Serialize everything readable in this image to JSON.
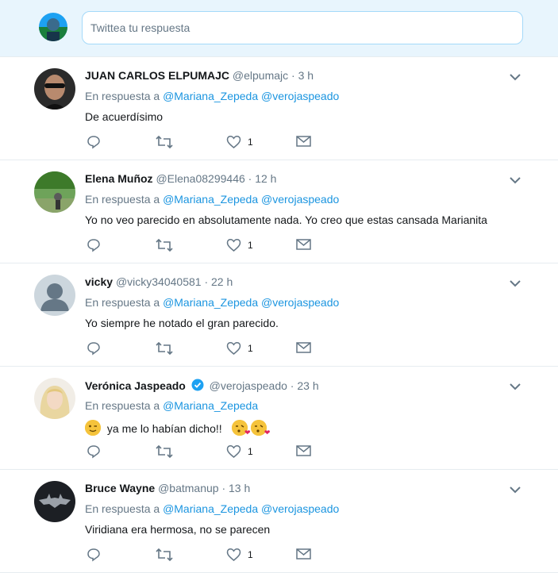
{
  "compose": {
    "placeholder": "Twittea tu respuesta",
    "avatar_icon": "user-avatar-icon"
  },
  "colors": {
    "accent": "#1b95e0",
    "compose_bg": "#e8f5fd",
    "muted": "#657786",
    "text": "#14171a",
    "border": "#e6ecf0"
  },
  "tweets": [
    {
      "name": "JUAN CARLOS ELPUMAJC",
      "handle": "@elpumajc",
      "dot": "·",
      "time": "3 h",
      "reply_prefix": "En respuesta a",
      "mentions": "@Mariana_Zepeda @verojaspeado",
      "text": "De acuerdísimo",
      "likes": "1"
    },
    {
      "name": "Elena Muñoz",
      "handle": "@Elena08299446",
      "dot": "·",
      "time": "12 h",
      "reply_prefix": "En respuesta a",
      "mentions": "@Mariana_Zepeda @verojaspeado",
      "text": "Yo no veo parecido en absolutamente nada. Yo creo que estas cansada Marianita",
      "likes": "1"
    },
    {
      "name": "vicky",
      "handle": "@vicky34040581",
      "dot": "·",
      "time": "22 h",
      "reply_prefix": "En respuesta a",
      "mentions": "@Mariana_Zepeda @verojaspeado",
      "text": "Yo siempre he notado el gran parecido.",
      "likes": "1"
    },
    {
      "name": "Verónica Jaspeado",
      "handle": "@verojaspeado",
      "dot": "·",
      "time": "23 h",
      "reply_prefix": "En respuesta a",
      "mentions": "@Mariana_Zepeda",
      "text": "ya me lo habían dicho!!",
      "likes": "1",
      "verified": true
    },
    {
      "name": "Bruce Wayne",
      "handle": "@batmanup",
      "dot": "·",
      "time": "13 h",
      "reply_prefix": "En respuesta a",
      "mentions": "@Mariana_Zepeda @verojaspeado",
      "text": "Viridiana era hermosa, no se parecen",
      "likes": "1"
    }
  ]
}
